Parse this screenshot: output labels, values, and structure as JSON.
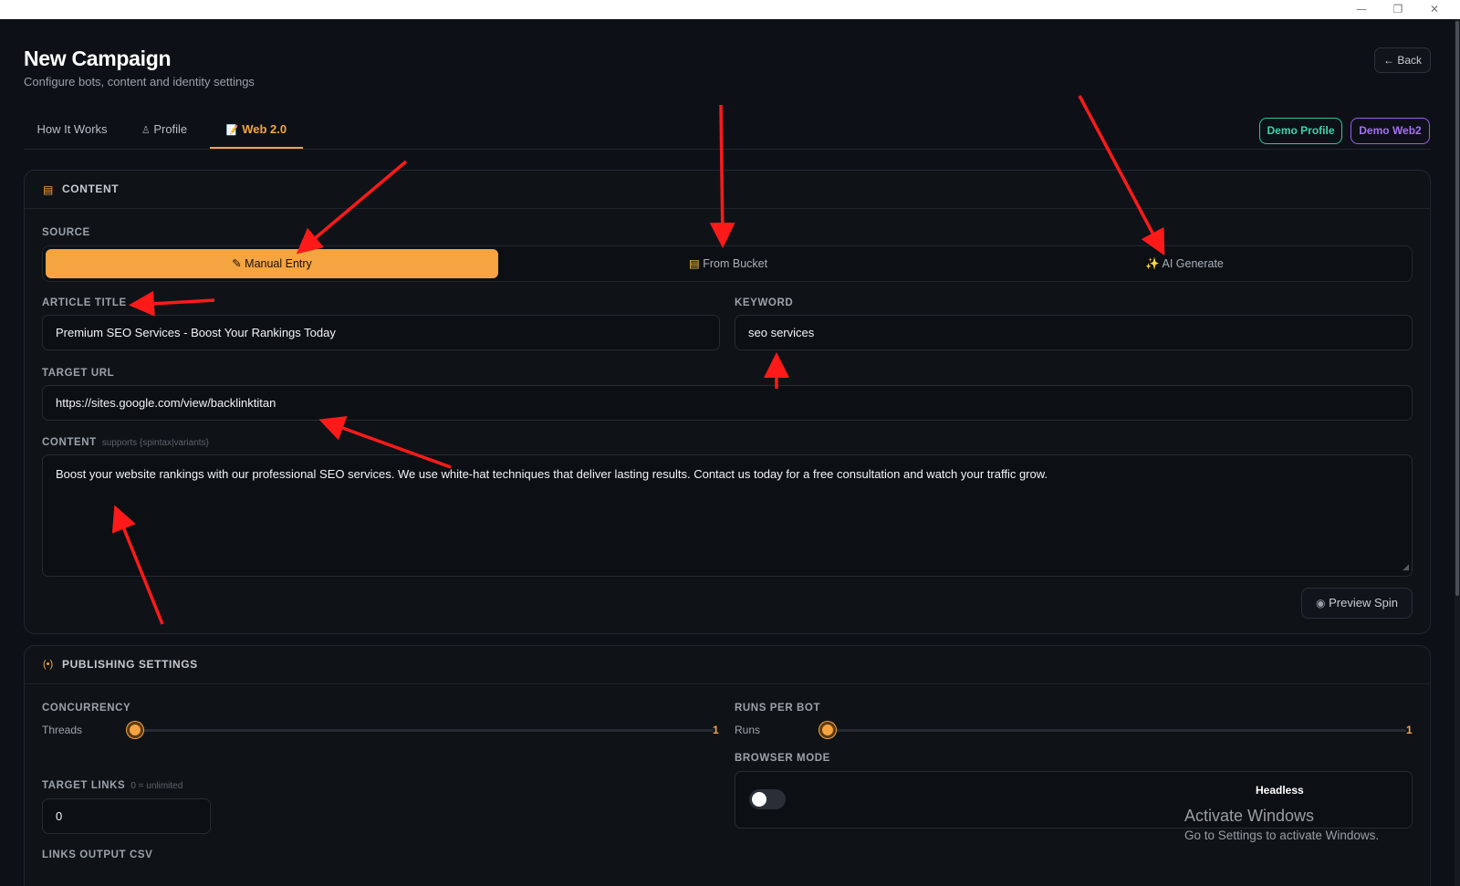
{
  "window": {
    "minimize": "—",
    "restore": "❐",
    "close": "✕"
  },
  "header": {
    "title": "New Campaign",
    "subtitle": "Configure bots, content and identity settings",
    "back_label": "← Back"
  },
  "tabs": [
    {
      "label": "How It Works",
      "icon": ""
    },
    {
      "label": "Profile",
      "icon": "user-icon"
    },
    {
      "label": "Web 2.0",
      "icon": "document-icon",
      "active": true
    }
  ],
  "demo_buttons": {
    "profile": "Demo Profile",
    "web2": "Demo Web2"
  },
  "content_card": {
    "title": "CONTENT",
    "source_label": "SOURCE",
    "source_options": [
      {
        "label": "Manual Entry",
        "icon": "pencil-icon",
        "active": true
      },
      {
        "label": "From Bucket",
        "icon": "folder-icon"
      },
      {
        "label": "AI Generate",
        "icon": "sparkles-icon"
      }
    ],
    "article_title_label": "ARTICLE TITLE",
    "article_title_value": "Premium SEO Services - Boost Your Rankings Today",
    "keyword_label": "KEYWORD",
    "keyword_value": "seo services",
    "target_url_label": "TARGET URL",
    "target_url_value": "https://sites.google.com/view/backlinktitan",
    "content_label": "CONTENT",
    "content_hint": "supports {spintax|variants}",
    "content_value": "Boost your website rankings with our professional SEO services. We use white-hat techniques that deliver lasting results. Contact us today for a free consultation and watch your traffic grow.",
    "preview_label": "Preview Spin"
  },
  "publishing_card": {
    "title": "PUBLISHING SETTINGS",
    "concurrency_label": "CONCURRENCY",
    "threads_label": "Threads",
    "threads_value": "1",
    "runs_label": "RUNS PER BOT",
    "runs_sub": "Runs",
    "runs_value": "1",
    "browser_mode_label": "BROWSER MODE",
    "browser_mode_value": "Headless",
    "headless_enabled": false,
    "target_links_label": "TARGET LINKS",
    "target_links_hint": "0 = unlimited",
    "target_links_value": "0",
    "links_output_label": "LINKS OUTPUT CSV"
  },
  "watermark": {
    "line1": "Activate Windows",
    "line2": "Go to Settings to activate Windows."
  },
  "colors": {
    "accent": "#f5a442",
    "green": "#3ad6a8",
    "purple": "#a770f5",
    "annotation": "#ff1a1a"
  }
}
